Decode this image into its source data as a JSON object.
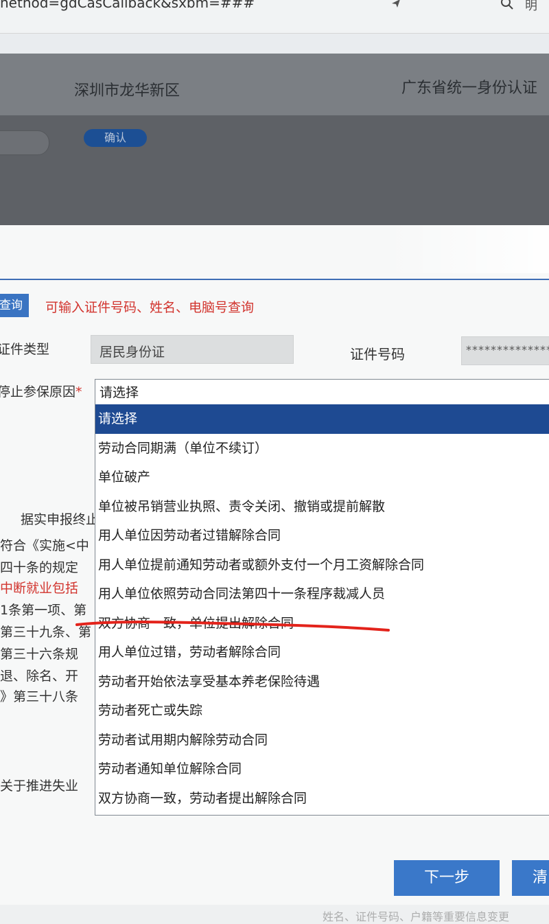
{
  "browser": {
    "url": "nethod=gdCasCallback&sxbm=###"
  },
  "header": {
    "district": "深圳市龙华新区",
    "auth_title": "广东省统一身份认证",
    "confirm_label": "确认"
  },
  "form": {
    "query_button": "查询",
    "hint": "可输入证件号码、姓名、电脑号查询",
    "id_type_label": "证件类型",
    "id_type_value": "居民身份证",
    "id_number_label": "证件号码",
    "id_number_value": "****************",
    "reason_label": "停止参保原因",
    "required_mark": "*",
    "reason_select": {
      "current": "请选择",
      "options": [
        "请选择",
        "劳动合同期满（单位不续订）",
        "单位破产",
        "单位被吊销营业执照、责令关闭、撤销或提前解散",
        "用人单位因劳动者过错解除合同",
        "用人单位提前通知劳动者或额外支付一个月工资解除合同",
        "用人单位依照劳动合同法第四十一条程序裁减人员",
        "双方协商一致，单位提出解除合同",
        "用人单位过错，劳动者解除合同",
        "劳动者开始依法享受基本养老保险待遇",
        "劳动者死亡或失踪",
        "劳动者试用期内解除劳动合同",
        "劳动者通知单位解除合同",
        "双方协商一致，劳动者提出解除合同"
      ],
      "selected_index": 0
    }
  },
  "background_notes": [
    "据实申报终止",
    "符合《实施<中",
    "四十条的规定",
    "中断就业包括",
    "1条第一项、第",
    "第三十九条、第",
    "第三十六条规",
    "退、除名、开",
    "》第三十八条",
    "关于推进失业"
  ],
  "buttons": {
    "next": "下一步",
    "clear": "清"
  },
  "footer_text": "姓名、证件号码、户籍等重要信息变更"
}
